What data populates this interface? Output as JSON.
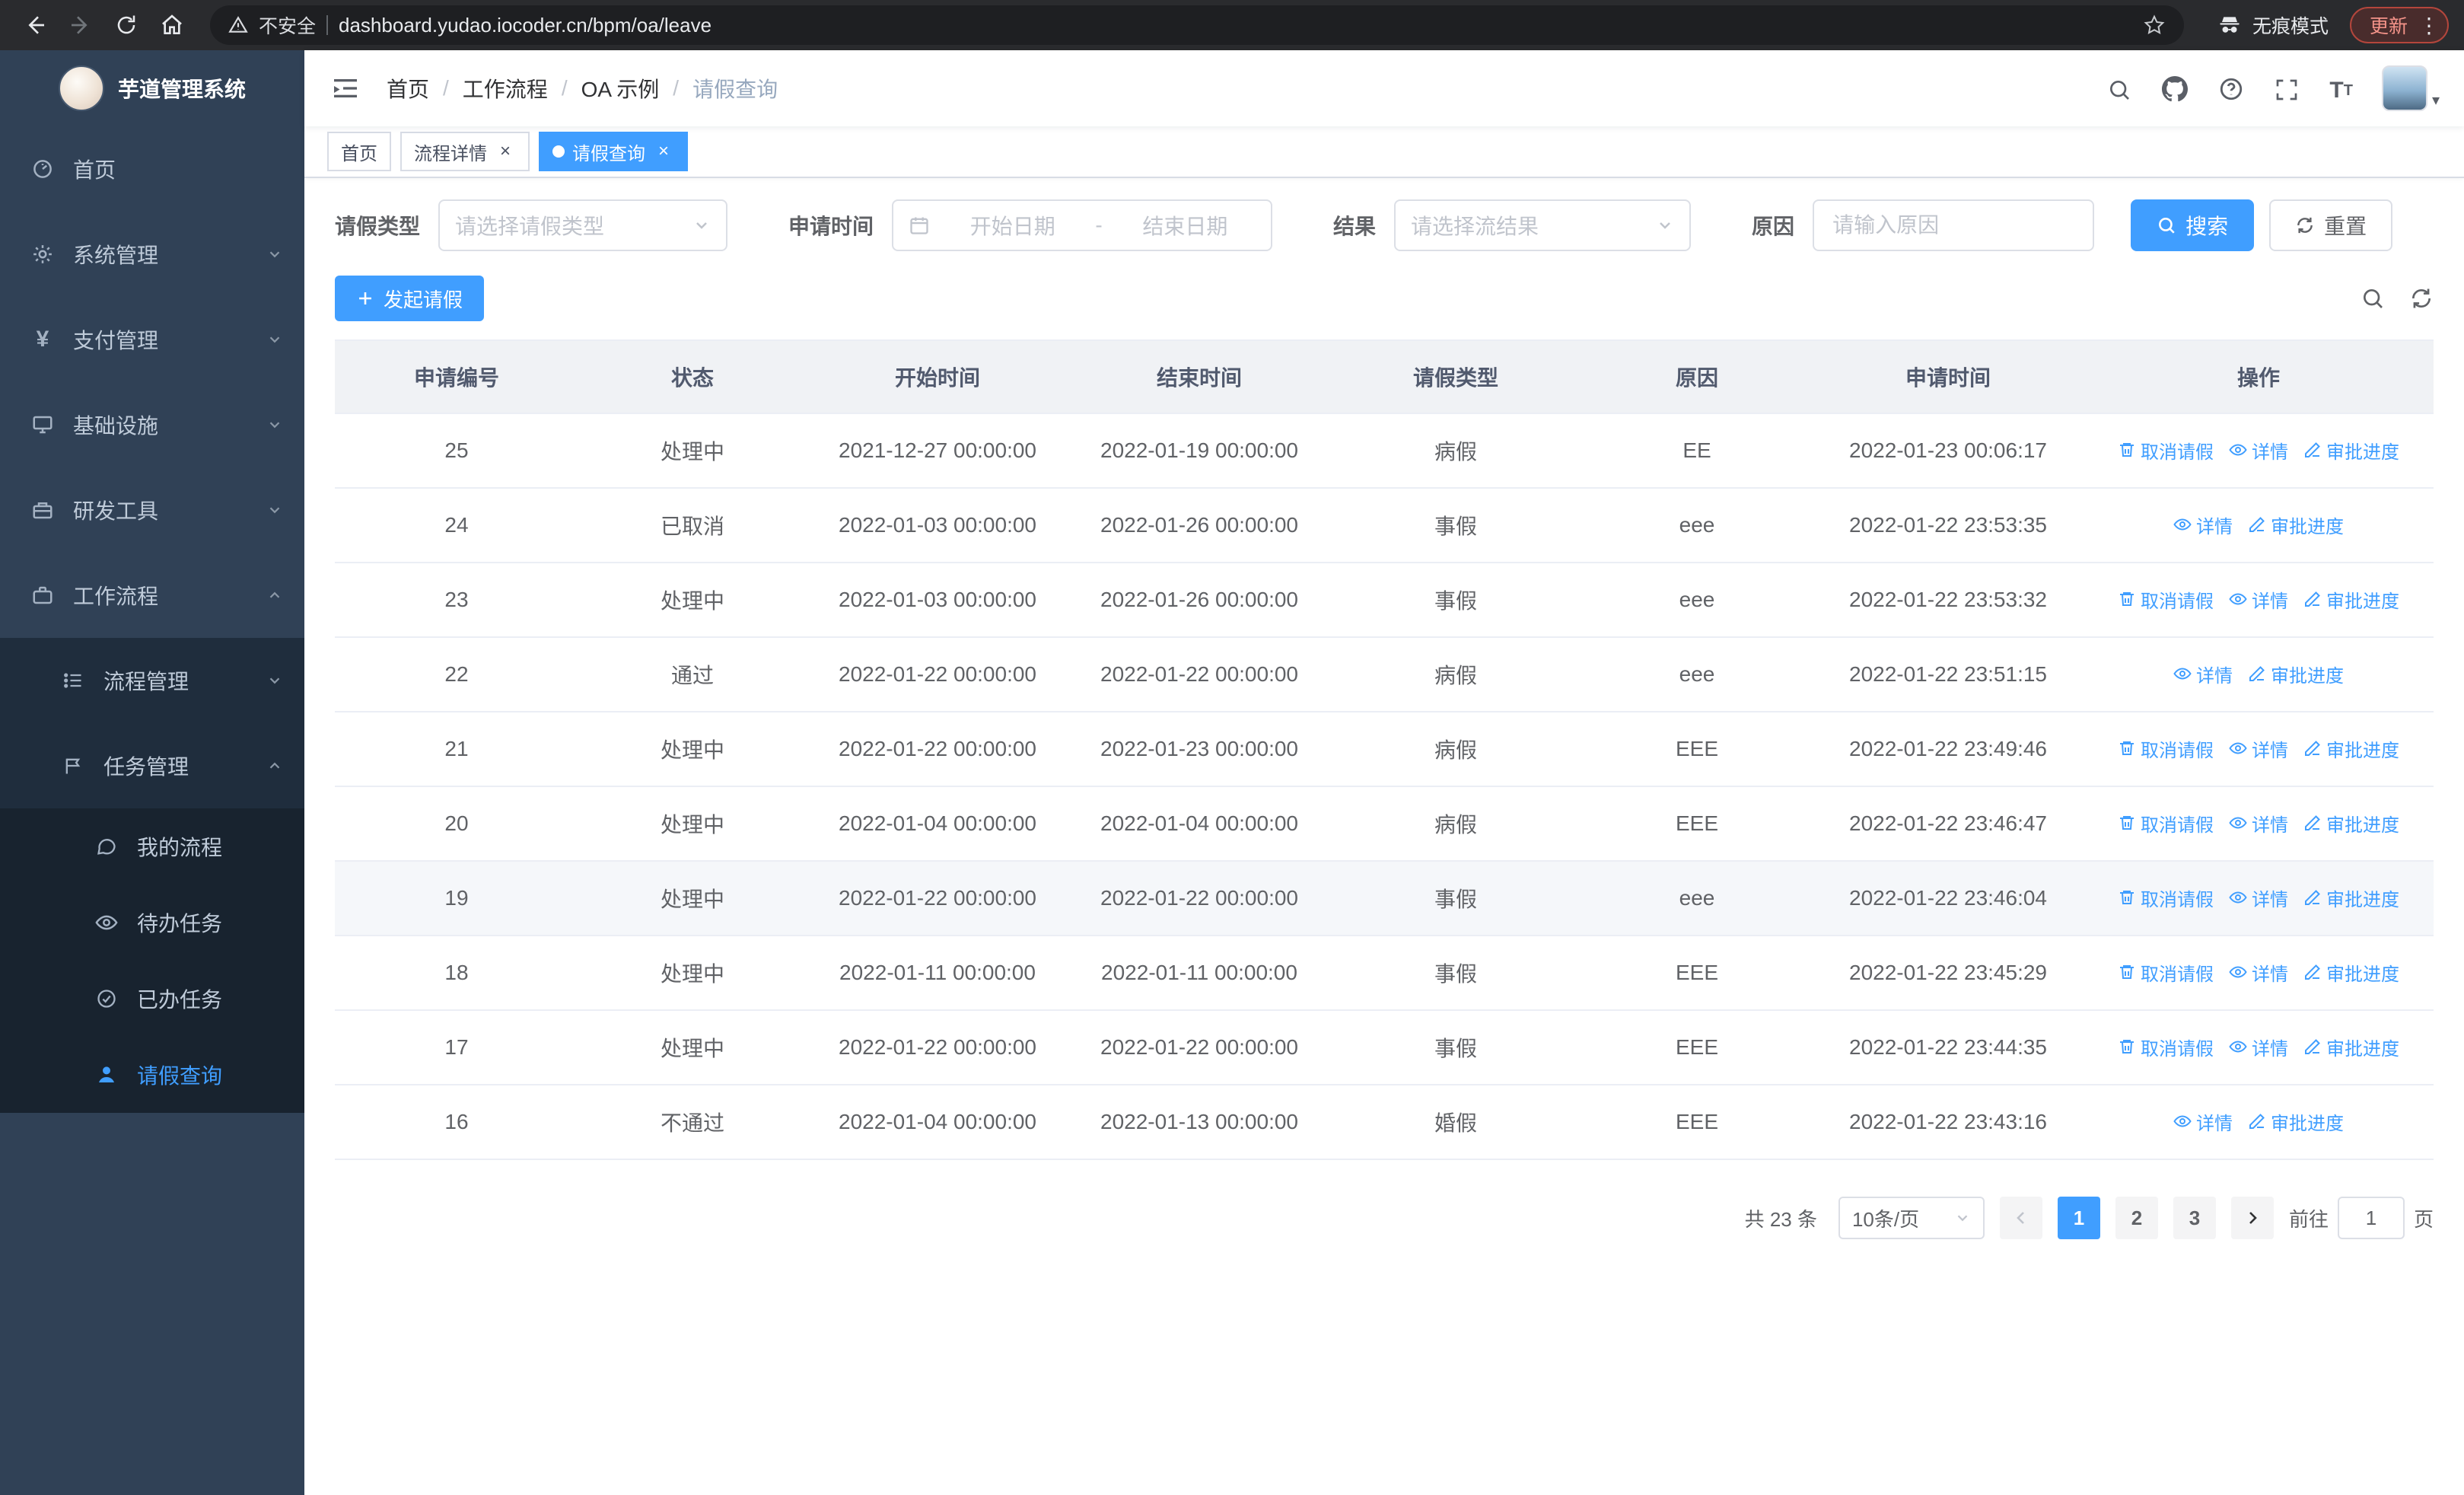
{
  "browser": {
    "security_label": "不安全",
    "url": "dashboard.yudao.iocoder.cn/bpm/oa/leave",
    "incognito_label": "无痕模式",
    "update_label": "更新"
  },
  "colors": {
    "accent": "#409eff",
    "sidebar_bg": "#304156",
    "submenu_bg": "#1f2d3d",
    "update_badge": "#f49389"
  },
  "icons": {
    "breadcrumb_separator": "/",
    "tab_close": "×",
    "menu_dots": "⋮",
    "caret_down": "▾"
  },
  "sidebar": {
    "app_title": "芋道管理系统",
    "items": [
      {
        "label": "首页"
      },
      {
        "label": "系统管理"
      },
      {
        "label": "支付管理"
      },
      {
        "label": "基础设施"
      },
      {
        "label": "研发工具"
      },
      {
        "label": "工作流程"
      }
    ],
    "workflow_children": [
      {
        "label": "流程管理"
      },
      {
        "label": "任务管理"
      }
    ],
    "task_children": [
      {
        "label": "我的流程"
      },
      {
        "label": "待办任务"
      },
      {
        "label": "已办任务"
      },
      {
        "label": "请假查询"
      }
    ]
  },
  "header": {
    "breadcrumb": [
      "首页",
      "工作流程",
      "OA 示例",
      "请假查询"
    ]
  },
  "tabs": [
    {
      "label": "首页"
    },
    {
      "label": "流程详情"
    },
    {
      "label": "请假查询"
    }
  ],
  "filters": {
    "leave_type_label": "请假类型",
    "leave_type_placeholder": "请选择请假类型",
    "apply_time_label": "申请时间",
    "date_start_placeholder": "开始日期",
    "date_separator": "-",
    "date_end_placeholder": "结束日期",
    "result_label": "结果",
    "result_placeholder": "请选择流结果",
    "reason_label": "原因",
    "reason_placeholder": "请输入原因",
    "search_button": "搜索",
    "reset_button": "重置"
  },
  "toolbar": {
    "create_button": "发起请假"
  },
  "table": {
    "columns": [
      "申请编号",
      "状态",
      "开始时间",
      "结束时间",
      "请假类型",
      "原因",
      "申请时间",
      "操作"
    ],
    "action_labels": {
      "cancel": "取消请假",
      "detail": "详情",
      "progress": "审批进度"
    },
    "rows": [
      {
        "id": "25",
        "status": "处理中",
        "start": "2021-12-27 00:00:00",
        "end": "2022-01-19 00:00:00",
        "type": "病假",
        "reason": "EE",
        "applied": "2022-01-23 00:06:17",
        "actions": [
          "cancel",
          "detail",
          "progress"
        ]
      },
      {
        "id": "24",
        "status": "已取消",
        "start": "2022-01-03 00:00:00",
        "end": "2022-01-26 00:00:00",
        "type": "事假",
        "reason": "eee",
        "applied": "2022-01-22 23:53:35",
        "actions": [
          "detail",
          "progress"
        ]
      },
      {
        "id": "23",
        "status": "处理中",
        "start": "2022-01-03 00:00:00",
        "end": "2022-01-26 00:00:00",
        "type": "事假",
        "reason": "eee",
        "applied": "2022-01-22 23:53:32",
        "actions": [
          "cancel",
          "detail",
          "progress"
        ]
      },
      {
        "id": "22",
        "status": "通过",
        "start": "2022-01-22 00:00:00",
        "end": "2022-01-22 00:00:00",
        "type": "病假",
        "reason": "eee",
        "applied": "2022-01-22 23:51:15",
        "actions": [
          "detail",
          "progress"
        ]
      },
      {
        "id": "21",
        "status": "处理中",
        "start": "2022-01-22 00:00:00",
        "end": "2022-01-23 00:00:00",
        "type": "病假",
        "reason": "EEE",
        "applied": "2022-01-22 23:49:46",
        "actions": [
          "cancel",
          "detail",
          "progress"
        ]
      },
      {
        "id": "20",
        "status": "处理中",
        "start": "2022-01-04 00:00:00",
        "end": "2022-01-04 00:00:00",
        "type": "病假",
        "reason": "EEE",
        "applied": "2022-01-22 23:46:47",
        "actions": [
          "cancel",
          "detail",
          "progress"
        ]
      },
      {
        "id": "19",
        "status": "处理中",
        "start": "2022-01-22 00:00:00",
        "end": "2022-01-22 00:00:00",
        "type": "事假",
        "reason": "eee",
        "applied": "2022-01-22 23:46:04",
        "actions": [
          "cancel",
          "detail",
          "progress"
        ],
        "highlighted": true
      },
      {
        "id": "18",
        "status": "处理中",
        "start": "2022-01-11 00:00:00",
        "end": "2022-01-11 00:00:00",
        "type": "事假",
        "reason": "EEE",
        "applied": "2022-01-22 23:45:29",
        "actions": [
          "cancel",
          "detail",
          "progress"
        ]
      },
      {
        "id": "17",
        "status": "处理中",
        "start": "2022-01-22 00:00:00",
        "end": "2022-01-22 00:00:00",
        "type": "事假",
        "reason": "EEE",
        "applied": "2022-01-22 23:44:35",
        "actions": [
          "cancel",
          "detail",
          "progress"
        ]
      },
      {
        "id": "16",
        "status": "不通过",
        "start": "2022-01-04 00:00:00",
        "end": "2022-01-13 00:00:00",
        "type": "婚假",
        "reason": "EEE",
        "applied": "2022-01-22 23:43:16",
        "actions": [
          "detail",
          "progress"
        ]
      }
    ]
  },
  "pagination": {
    "total": "共 23 条",
    "page_size": "10条/页",
    "pages": [
      "1",
      "2",
      "3"
    ],
    "active_page": "1",
    "goto_label": "前往",
    "goto_value": "1",
    "page_label": "页"
  }
}
